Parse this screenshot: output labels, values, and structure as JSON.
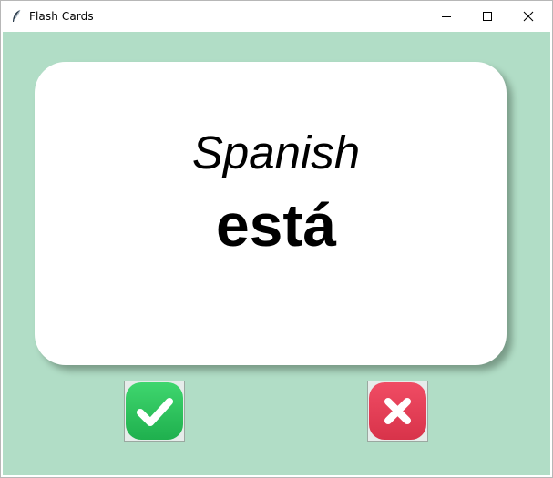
{
  "window": {
    "title": "Flash Cards"
  },
  "card": {
    "title": "Spanish",
    "word": "está"
  },
  "buttons": {
    "right_icon": "checkmark-icon",
    "wrong_icon": "x-mark-icon"
  },
  "colors": {
    "background": "#b1ddc6",
    "right_button": "#2fc65f",
    "wrong_button": "#e8405a"
  }
}
